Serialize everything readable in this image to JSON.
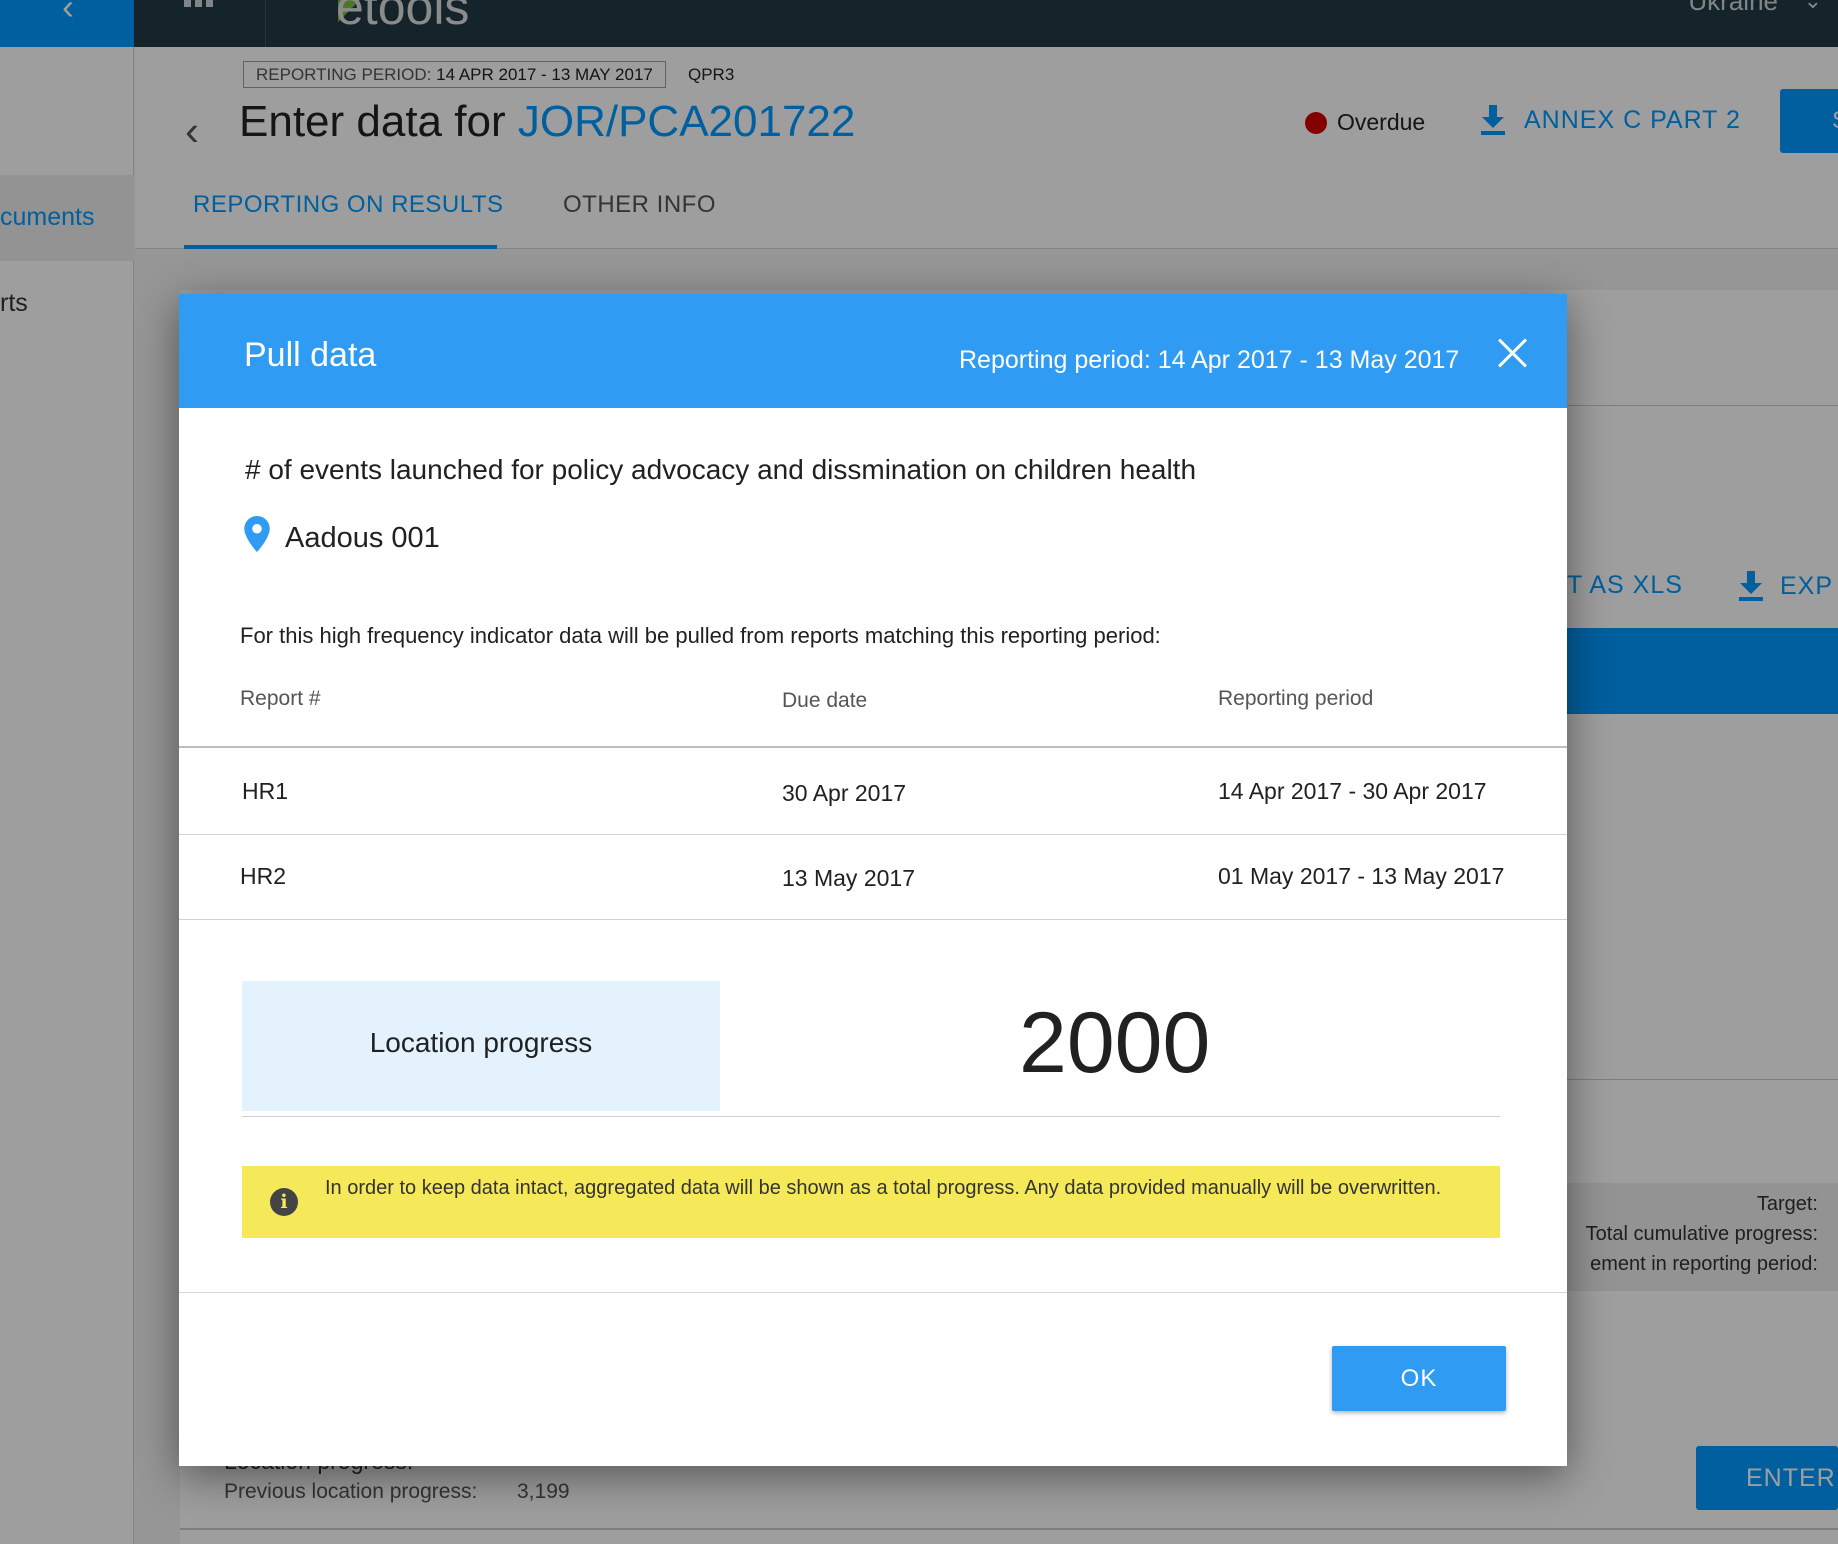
{
  "app": {
    "logo": "etools",
    "country": "Ukraine"
  },
  "sidebar": {
    "items": [
      {
        "label": "cuments",
        "active": true
      },
      {
        "label": "rts",
        "active": false
      }
    ]
  },
  "header": {
    "period_label": "REPORTING PERIOD:",
    "period_value": "14 APR 2017 - 13 MAY 2017",
    "report_code": "QPR3",
    "title_prefix": "Enter data for",
    "title_ref": "JOR/PCA201722",
    "status_label": "Overdue",
    "status_color": "#d50000",
    "annex_label": "ANNEX C PART 2",
    "submit_label": "S",
    "tabs": [
      {
        "label": "REPORTING ON RESULTS",
        "active": true
      },
      {
        "label": "OTHER INFO",
        "active": false
      }
    ]
  },
  "background": {
    "export_xls_label": "T AS XLS",
    "export_label": "EXP",
    "target_label": "Target:",
    "total_progress_label": "Total cumulative progress:",
    "achievement_label": "ement in reporting period:",
    "enter_label": "ENTER",
    "location_progress_title": "Location progress:",
    "previous_progress_label": "Previous location progress:",
    "previous_progress_value": "3,199"
  },
  "modal": {
    "title": "Pull data",
    "period": "Reporting period: 14 Apr 2017 - 13 May 2017",
    "indicator": "# of events launched for policy advocacy and dissmination on children health",
    "location": "Aadous 001",
    "description": "For this high frequency indicator data will be pulled from reports matching this reporting period:",
    "table": {
      "headers": [
        "Report #",
        "Due date",
        "Reporting period"
      ],
      "rows": [
        [
          "HR1",
          "30 Apr 2017",
          "14 Apr 2017 - 30 Apr 2017"
        ],
        [
          "HR2",
          "13 May 2017",
          "01 May 2017 - 13 May 2017"
        ]
      ]
    },
    "progress_label": "Location progress",
    "progress_value": "2000",
    "warning": "In order to keep data intact, aggregated data will be shown as a total progress. Any data provided manually will be overwritten.",
    "ok_label": "OK",
    "accent_color": "#2f9bf2",
    "warning_color": "#f5e95a"
  }
}
